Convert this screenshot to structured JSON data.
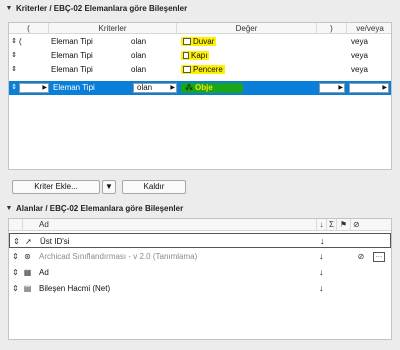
{
  "criteria_section": {
    "title": "Kriterler / EBÇ-02 Elemanlara göre Bileşenler",
    "headers": {
      "open_paren": "(",
      "criteria": "Kriterler",
      "value": "Değer",
      "close_paren": ")",
      "andor": "ve/veya"
    },
    "rows": [
      {
        "paren": "(",
        "criteria": "Eleman Tipi",
        "operator": "olan",
        "value": "Duvar",
        "andor": "veya"
      },
      {
        "paren": "",
        "criteria": "Eleman Tipi",
        "operator": "olan",
        "value": "Kapı",
        "andor": "veya"
      },
      {
        "paren": "",
        "criteria": "Eleman Tipi",
        "operator": "olan",
        "value": "Pencere",
        "andor": "veya"
      },
      {
        "paren": "",
        "criteria": "Eleman Tipi",
        "operator": "olan",
        "value": "Obje",
        "andor": ""
      }
    ],
    "add_button": "Kriter Ekle...",
    "remove_button": "Kaldır"
  },
  "fields_section": {
    "title": "Alanlar / EBÇ-02 Elemanlara göre Bileşenler",
    "header_name": "Ad",
    "header_sort": "↓",
    "header_sum": "Σ",
    "rows": [
      {
        "name": "Üst ID'si",
        "muted": false,
        "sort": "↓"
      },
      {
        "name": "Archicad Sınıflandırması - v 2.0 (Tanımlama)",
        "muted": true,
        "sort": "↓"
      },
      {
        "name": "Ad",
        "muted": false,
        "sort": "↓"
      },
      {
        "name": "Bileşen Hacmi (Net)",
        "muted": false,
        "sort": "↓"
      }
    ]
  },
  "colors": {
    "selection": "#0a7fd9",
    "highlight": "#fff200",
    "obje_fill": "#1ba51b"
  }
}
